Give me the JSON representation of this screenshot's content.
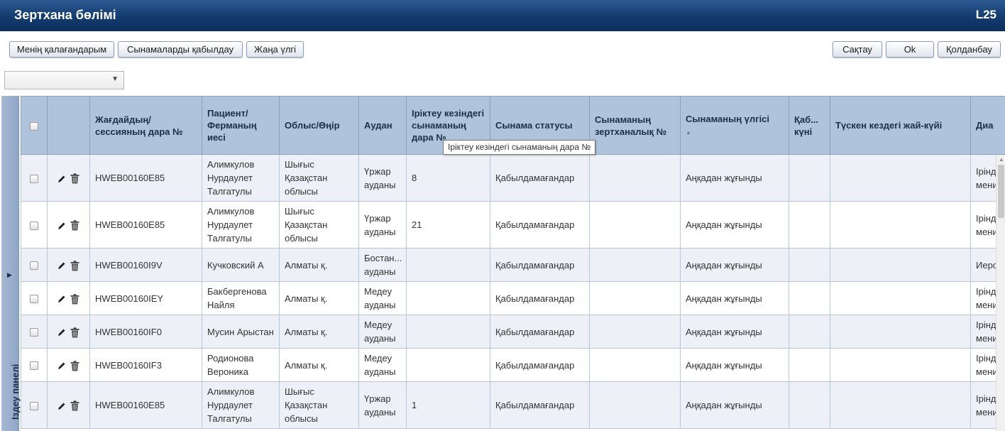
{
  "header": {
    "title": "Зертхана бөлімі",
    "code": "L25"
  },
  "toolbar": {
    "my_favorites": "Менің қалағандарым",
    "accept_samples": "Сынамаларды қабылдау",
    "new_sample": "Жаңа үлгі",
    "save": "Сақтау",
    "ok": "Ok",
    "cancel": "Қолданбау"
  },
  "filter": {
    "selected": ""
  },
  "side_panel": {
    "label": "Іздеу панелі"
  },
  "tooltip": {
    "text": "Іріктеу кезіндегі сынаманың дара №"
  },
  "table": {
    "columns": {
      "case_id": "Жағдайдың/ сессияның дара №",
      "patient": "Пациент/ Ферманың иесі",
      "region": "Облыс/Өңір",
      "district": "Аудан",
      "field_sample_id": "Іріктеу кезіндегі сынаманың дара №",
      "status": "Сынама статусы",
      "lab_id": "Сынаманың зертханалық №",
      "sample_type": "Сынаманың үлгісі",
      "accepted_date": "Қаб... күні",
      "condition": "Түскен кездегі жай-күйі",
      "diag": "Диа"
    },
    "rows": [
      {
        "case_id": "HWEB00160E85",
        "patient": "Алимкулов Нурдаулет Талгатулы",
        "region": "Шығыс Қазақстан облысы",
        "district": "Үржар ауданы",
        "field_sample_id": "8",
        "status": "Қабылдамағандар",
        "lab_id": "",
        "sample_type": "Аңқадан жұғынды",
        "accepted_date": "",
        "condition": "",
        "diag": "Іріндт мени"
      },
      {
        "case_id": "HWEB00160E85",
        "patient": "Алимкулов Нурдаулет Талгатулы",
        "region": "Шығыс Қазақстан облысы",
        "district": "Үржар ауданы",
        "field_sample_id": "21",
        "status": "Қабылдамағандар",
        "lab_id": "",
        "sample_type": "Аңқадан жұғынды",
        "accepted_date": "",
        "condition": "",
        "diag": "Іріндт мени"
      },
      {
        "case_id": "HWEB00160I9V",
        "patient": "Кучковский А",
        "region": "Алматы қ.",
        "district": "Бостан... ауданы",
        "field_sample_id": "",
        "status": "Қабылдамағандар",
        "lab_id": "",
        "sample_type": "Аңқадан жұғынды",
        "accepted_date": "",
        "condition": "",
        "diag": "Иерс"
      },
      {
        "case_id": "HWEB00160IEY",
        "patient": "Бакбергенова Найля",
        "region": "Алматы қ.",
        "district": "Медеу ауданы",
        "field_sample_id": "",
        "status": "Қабылдамағандар",
        "lab_id": "",
        "sample_type": "Аңқадан жұғынды",
        "accepted_date": "",
        "condition": "",
        "diag": "Іріндт мени"
      },
      {
        "case_id": "HWEB00160IF0",
        "patient": "Мусин Арыстан",
        "region": "Алматы қ.",
        "district": "Медеу ауданы",
        "field_sample_id": "",
        "status": "Қабылдамағандар",
        "lab_id": "",
        "sample_type": "Аңқадан жұғынды",
        "accepted_date": "",
        "condition": "",
        "diag": "Іріндт мени"
      },
      {
        "case_id": "HWEB00160IF3",
        "patient": "Родионова Вероника",
        "region": "Алматы қ.",
        "district": "Медеу ауданы",
        "field_sample_id": "",
        "status": "Қабылдамағандар",
        "lab_id": "",
        "sample_type": "Аңқадан жұғынды",
        "accepted_date": "",
        "condition": "",
        "diag": "Іріндт мени"
      },
      {
        "case_id": "HWEB00160E85",
        "patient": "Алимкулов Нурдаулет Талгатулы",
        "region": "Шығыс Қазақстан облысы",
        "district": "Үржар ауданы",
        "field_sample_id": "1",
        "status": "Қабылдамағандар",
        "lab_id": "",
        "sample_type": "Аңқадан жұғынды",
        "accepted_date": "",
        "condition": "",
        "diag": "Іріндт мени"
      }
    ]
  },
  "colors": {
    "header_bg": "#133c6f",
    "grid_header_bg": "#afc3dc",
    "alt_row_bg": "#edf1f7"
  }
}
